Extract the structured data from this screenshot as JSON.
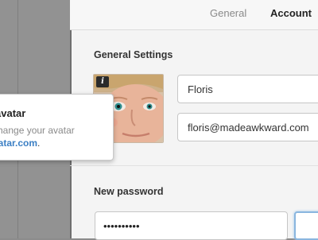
{
  "tabs": {
    "general": "General",
    "account": "Account"
  },
  "general_settings": {
    "title": "General Settings",
    "name_value": "Floris",
    "email_value": "floris@madeawkward.com"
  },
  "avatar_popover": {
    "title": "avatar",
    "text": "change your avatar",
    "link": "vatar.com",
    "link_suffix": "."
  },
  "new_password": {
    "title": "New password",
    "current_value": "••••••••••"
  },
  "icons": {
    "info": "i"
  },
  "colors": {
    "link": "#3b7fc4",
    "focus_ring": "#8ab6df",
    "panel_bg": "#f4f4f4"
  }
}
